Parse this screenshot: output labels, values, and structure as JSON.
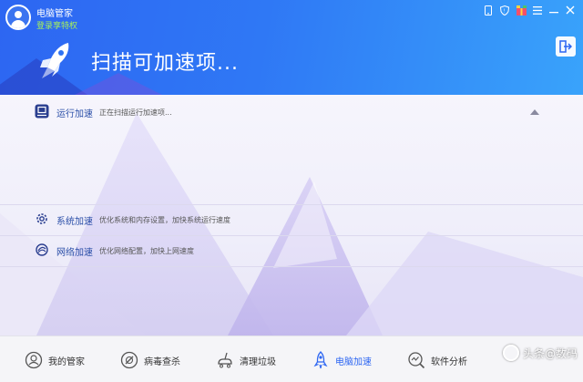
{
  "header": {
    "app_title": "电脑管家",
    "login_link": "登录享特权",
    "scan_title": "扫描可加速项..."
  },
  "window_controls": [
    "phone-icon",
    "shield-icon",
    "gift-icon",
    "menu-icon",
    "minimize-icon",
    "close-icon"
  ],
  "rows": [
    {
      "label": "运行加速",
      "desc": "正在扫描运行加速项...",
      "icon": "run-speedup-icon"
    },
    {
      "label": "系统加速",
      "desc": "优化系统和内存设置，加快系统运行速度",
      "icon": "gear-icon"
    },
    {
      "label": "网络加速",
      "desc": "优化网络配置，加快上网速度",
      "icon": "network-icon"
    }
  ],
  "bottom_nav": [
    {
      "label": "我的管家",
      "icon": "butler-icon"
    },
    {
      "label": "病毒查杀",
      "icon": "virus-scan-icon"
    },
    {
      "label": "清理垃圾",
      "icon": "cleanup-icon"
    },
    {
      "label": "电脑加速",
      "icon": "rocket-icon",
      "active": true
    },
    {
      "label": "软件分析",
      "icon": "software-analysis-icon"
    }
  ],
  "watermark": "头条@数码",
  "colors": {
    "accent": "#2d66f2",
    "login_link": "#a6f05a",
    "row_label": "#2b4fa8"
  }
}
